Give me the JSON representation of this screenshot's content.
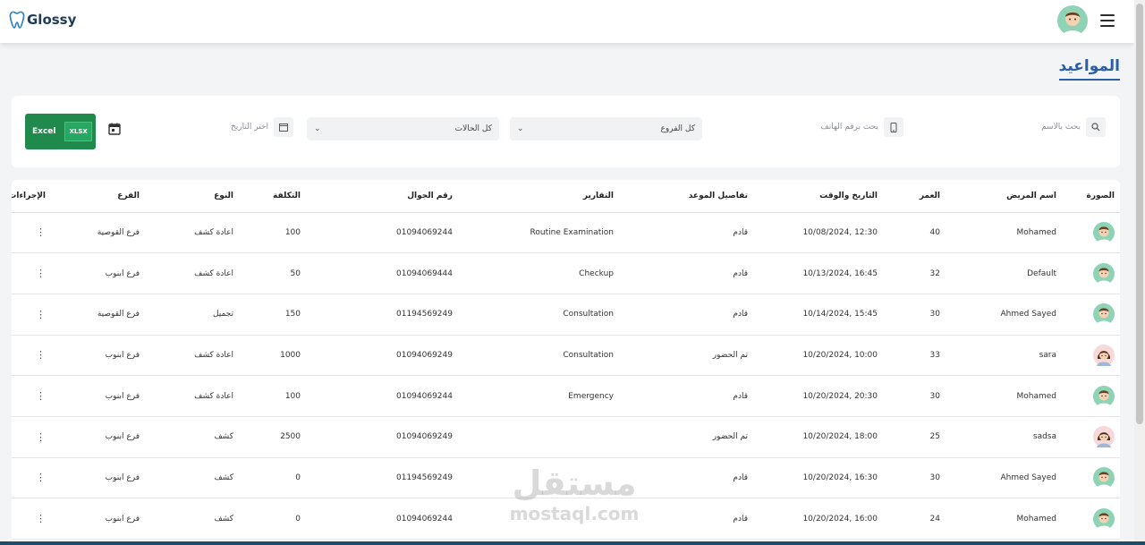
{
  "app": {
    "logo_text": "Glossy"
  },
  "page": {
    "title": "المواعيد"
  },
  "filters": {
    "search_name_placeholder": "بحث بالاسم",
    "search_phone_placeholder": "بحث برقم الهاتف",
    "branches_select": "كل الفروع",
    "status_select": "كل الحالات",
    "date_placeholder": "اختر التاريخ",
    "excel_label": "Excel",
    "xlsx_label": "XLSX"
  },
  "table": {
    "headers": [
      "الصورة",
      "اسم المريض",
      "العمر",
      "التاريخ والوقت",
      "تفاصيل الموعد",
      "التقارير",
      "رقم الجوال",
      "التكلفة",
      "النوع",
      "الفرع",
      "الإجراءات"
    ],
    "rows": [
      {
        "avatar": "male",
        "name": "Mohamed",
        "age": "40",
        "datetime": "12:30 ,10/08/2024",
        "details": "قادم",
        "report": "Routine Examination",
        "phone": "01094069244",
        "cost": "100",
        "type": "اعادة كشف",
        "branch": "فرع القوصية",
        "actions": "⋮"
      },
      {
        "avatar": "male",
        "name": "Default",
        "age": "32",
        "datetime": "16:45 ,10/13/2024",
        "details": "قادم",
        "report": "Checkup",
        "phone": "01094069444",
        "cost": "50",
        "type": "اعادة كشف",
        "branch": "فرع ابنوب",
        "actions": "⋮"
      },
      {
        "avatar": "male",
        "name": "Ahmed Sayed",
        "age": "30",
        "datetime": "15:45 ,10/14/2024",
        "details": "قادم",
        "report": "Consultation",
        "phone": "01194569249",
        "cost": "150",
        "type": "تجميل",
        "branch": "فرع القوصية",
        "actions": "⋮"
      },
      {
        "avatar": "female",
        "name": "sara",
        "age": "33",
        "datetime": "10:00 ,10/20/2024",
        "details": "تم الحضور",
        "report": "Consultation",
        "phone": "01094069249",
        "cost": "1000",
        "type": "اعادة كشف",
        "branch": "فرع ابنوب",
        "actions": "⋮"
      },
      {
        "avatar": "male",
        "name": "Mohamed",
        "age": "30",
        "datetime": "20:30 ,10/20/2024",
        "details": "قادم",
        "report": "Emergency",
        "phone": "01094069244",
        "cost": "100",
        "type": "اعادة كشف",
        "branch": "فرع ابنوب",
        "actions": "⋮"
      },
      {
        "avatar": "female",
        "name": "sadsa",
        "age": "25",
        "datetime": "18:00 ,10/20/2024",
        "details": "تم الحضور",
        "report": "",
        "phone": "01094069249",
        "cost": "2500",
        "type": "كشف",
        "branch": "فرع ابنوب",
        "actions": "⋮"
      },
      {
        "avatar": "male",
        "name": "Ahmed Sayed",
        "age": "30",
        "datetime": "16:30 ,10/20/2024",
        "details": "قادم",
        "report": "",
        "phone": "01194569249",
        "cost": "0",
        "type": "كشف",
        "branch": "فرع ابنوب",
        "actions": "⋮"
      },
      {
        "avatar": "male",
        "name": "Mohamed",
        "age": "24",
        "datetime": "16:00 ,10/20/2024",
        "details": "قادم",
        "report": "",
        "phone": "01094069244",
        "cost": "0",
        "type": "كشف",
        "branch": "فرع ابنوب",
        "actions": "⋮"
      }
    ]
  },
  "watermark": {
    "arabic": "مستقل",
    "latin": "mostaql.com"
  },
  "colors": {
    "brand": "#2a5fa8",
    "excel": "#1f8a4c",
    "footer": "#1d4d6b"
  },
  "icons": [
    "tooth-logo-icon",
    "user-avatar-icon",
    "hamburger-menu-icon",
    "search-icon",
    "phone-icon",
    "chevron-down-icon",
    "calendar-icon",
    "excel-icon",
    "kebab-menu-icon"
  ]
}
